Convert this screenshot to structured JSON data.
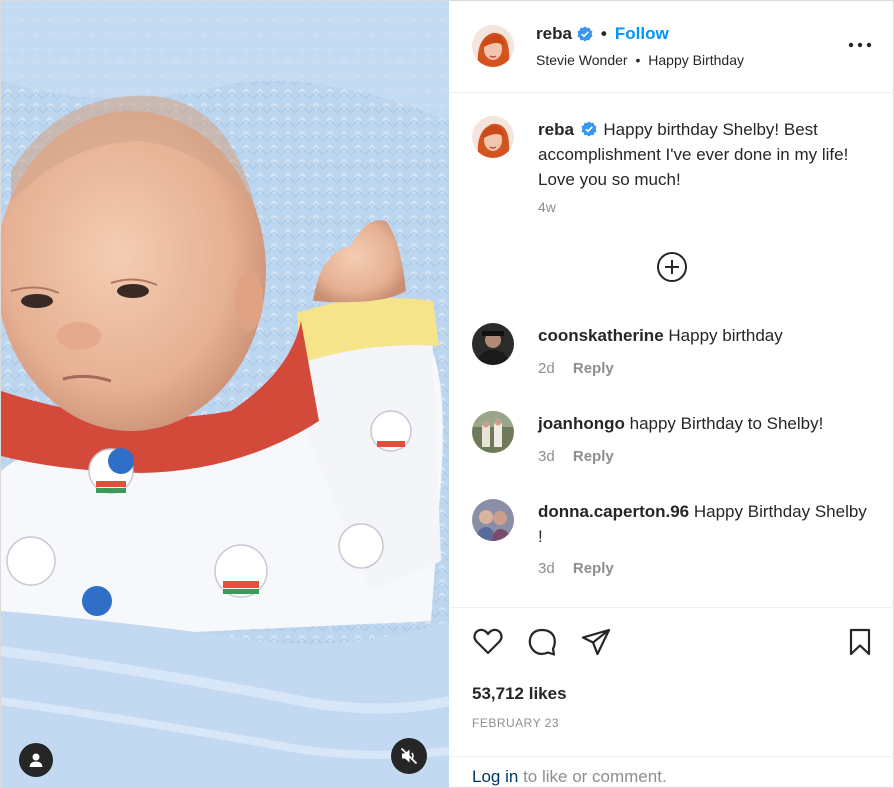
{
  "post": {
    "author": {
      "username": "reba",
      "verified": true,
      "follow_label": "Follow",
      "separator": "•",
      "audio": "Stevie Wonder",
      "location": "Happy Birthday",
      "sub_separator": "•"
    },
    "more_icon": "more-horizontal-icon",
    "caption": {
      "username": "reba",
      "text": "Happy birthday Shelby! Best accomplishment I've ever done in my life! Love you so much!",
      "time": "4w"
    },
    "load_more_icon": "plus-circle-icon",
    "comments": [
      {
        "username": "coonskatherine",
        "text": "Happy birthday",
        "time": "2d",
        "reply_label": "Reply"
      },
      {
        "username": "joanhongo",
        "text": "happy Birthday to Shelby!",
        "time": "3d",
        "reply_label": "Reply"
      },
      {
        "username": "donna.caperton.96",
        "text": "Happy Birthday Shelby !",
        "time": "3d",
        "reply_label": "Reply"
      }
    ],
    "actions": {
      "like_icon": "heart-icon",
      "comment_icon": "comment-icon",
      "share_icon": "send-icon",
      "save_icon": "bookmark-icon"
    },
    "likes": "53,712 likes",
    "date": "FEBRUARY 23",
    "login": {
      "link": "Log in",
      "text": "to like or comment."
    },
    "media": {
      "description_icons": [
        "user-tag-icon",
        "mute-icon"
      ]
    },
    "colors": {
      "accent": "#0095f6",
      "link": "#00376b",
      "muted": "#8e8e8e",
      "verified": "#3897f0"
    }
  }
}
